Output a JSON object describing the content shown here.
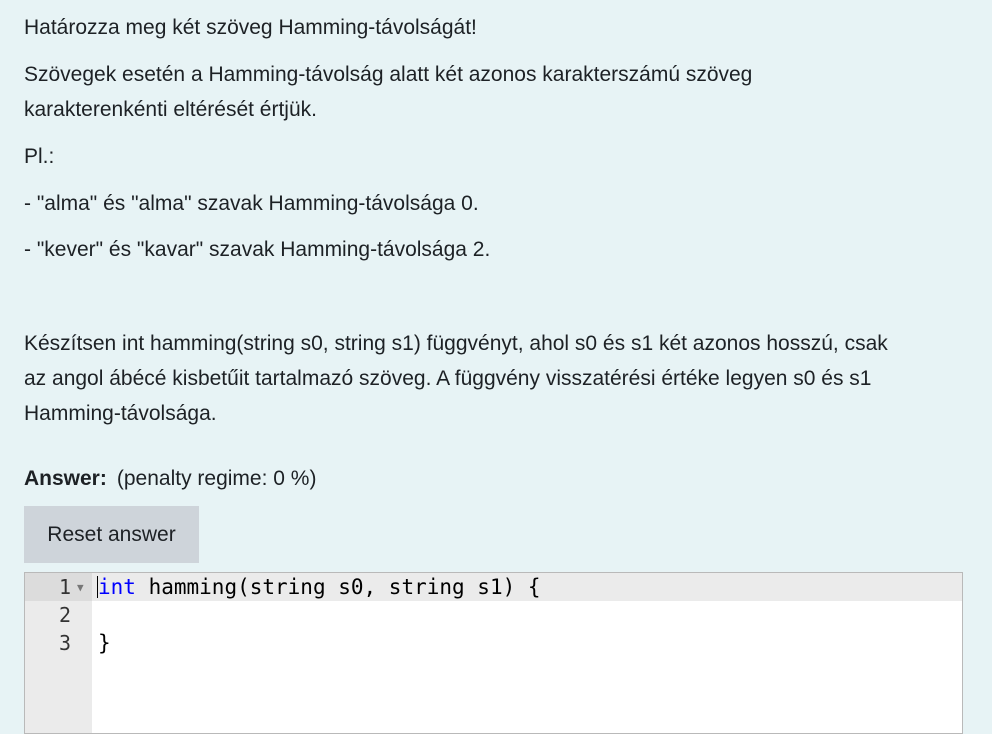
{
  "question": {
    "title": "Határozza meg két szöveg Hamming-távolságát!",
    "desc_line1": "Szövegek esetén a Hamming-távolság alatt két azonos karakterszámú szöveg",
    "desc_line2": "karakterenkénti eltérését értjük.",
    "example_label": "Pl.:",
    "example1": " - \"alma\" és \"alma\" szavak Hamming-távolsága 0.",
    "example2": " - \"kever\" és \"kavar\" szavak Hamming-távolsága 2.",
    "task_line1": "Készítsen int hamming(string s0, string s1) függvényt, ahol s0 és s1 két azonos hosszú, csak",
    "task_line2": "az angol ábécé kisbetűit tartalmazó szöveg. A függvény visszatérési értéke legyen s0 és s1",
    "task_line3": "Hamming-távolsága."
  },
  "answer": {
    "label": "Answer:",
    "penalty": "(penalty regime: 0 %)",
    "reset_label": "Reset answer"
  },
  "editor": {
    "line_numbers": [
      "1",
      "2",
      "3"
    ],
    "line1_keyword": "int",
    "line1_rest": " hamming(string s0, string s1) {",
    "line2": "",
    "line3": "}"
  },
  "colors": {
    "page_bg": "#e7f3f5",
    "button_bg": "#ced4da",
    "keyword": "#0000ff",
    "gutter_bg": "#ebebeb"
  }
}
